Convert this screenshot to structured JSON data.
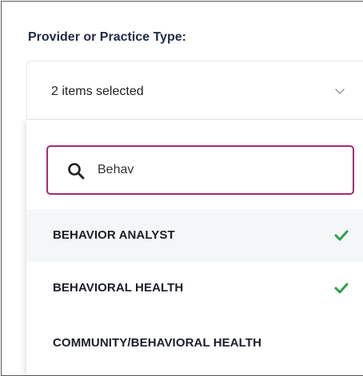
{
  "filter": {
    "label": "Provider or Practice Type:",
    "selected_summary": "2 items selected",
    "dropdown_icon": "chevron-down-icon"
  },
  "search": {
    "value": "Behav",
    "icon": "search-icon"
  },
  "options": [
    {
      "label": "BEHAVIOR ANALYST",
      "selected": true,
      "highlighted": true
    },
    {
      "label": "BEHAVIORAL HEALTH",
      "selected": true,
      "highlighted": false
    },
    {
      "label": "COMMUNITY/BEHAVIORAL HEALTH",
      "selected": false,
      "highlighted": false
    }
  ],
  "colors": {
    "accent_border": "#a52a6f",
    "check": "#2e9e4a",
    "highlight_row": "#f4f7f8",
    "label_text": "#1f2a44"
  }
}
